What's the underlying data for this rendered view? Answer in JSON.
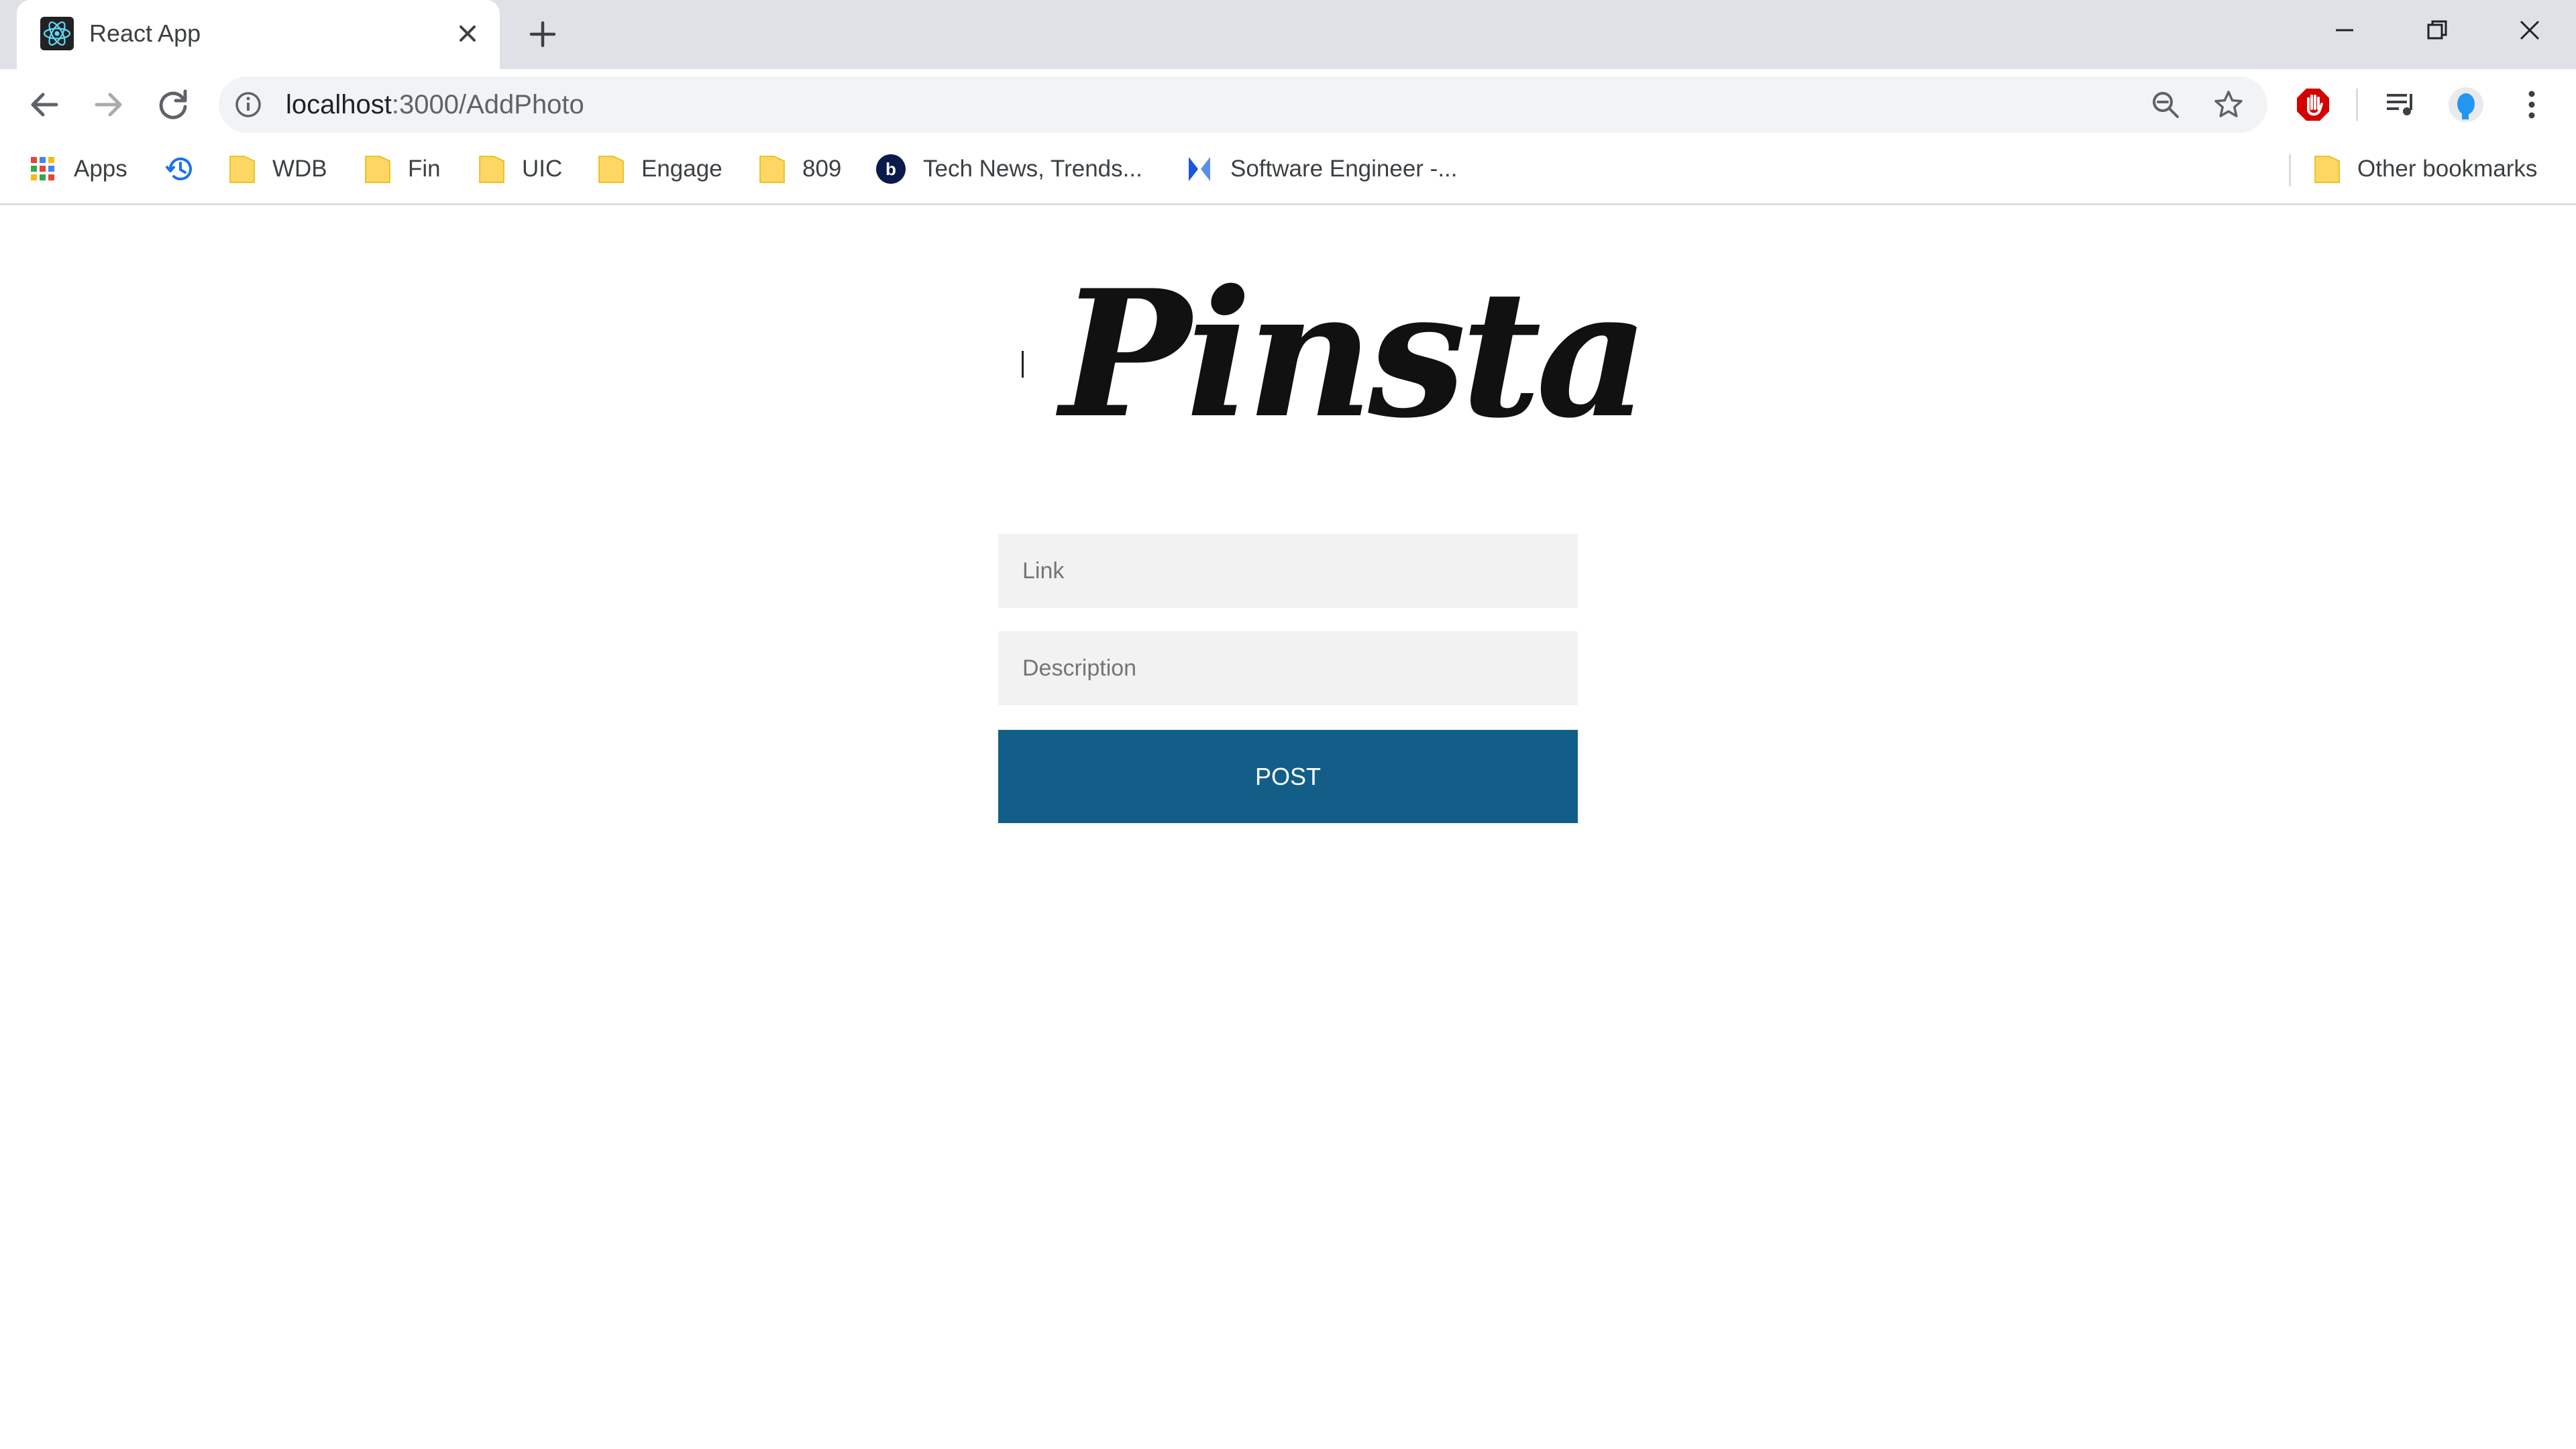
{
  "browser": {
    "tab": {
      "title": "React App",
      "favicon": "react-logo-icon"
    },
    "address_bar": {
      "host": "localhost",
      "path": ":3000/AddPhoto"
    },
    "bookmarks": [
      {
        "label": "Apps",
        "icon": "apps-grid-icon"
      },
      {
        "label": "",
        "icon": "history-icon"
      },
      {
        "label": "WDB",
        "icon": "folder-icon"
      },
      {
        "label": "Fin",
        "icon": "folder-icon"
      },
      {
        "label": "UIC",
        "icon": "folder-icon"
      },
      {
        "label": "Engage",
        "icon": "folder-icon"
      },
      {
        "label": "809",
        "icon": "folder-icon"
      },
      {
        "label": "Tech News, Trends...",
        "icon": "site-b-icon"
      },
      {
        "label": "Software Engineer -...",
        "icon": "site-bracket-icon"
      }
    ],
    "other_bookmarks": "Other bookmarks"
  },
  "page": {
    "logo": "Pinsta",
    "form": {
      "link_placeholder": "Link",
      "description_placeholder": "Description",
      "post_label": "POST"
    }
  },
  "colors": {
    "accent": "#125e88",
    "field_bg": "#f2f2f2",
    "tabstrip_bg": "#dee1e6",
    "folder": "#fdd663"
  }
}
